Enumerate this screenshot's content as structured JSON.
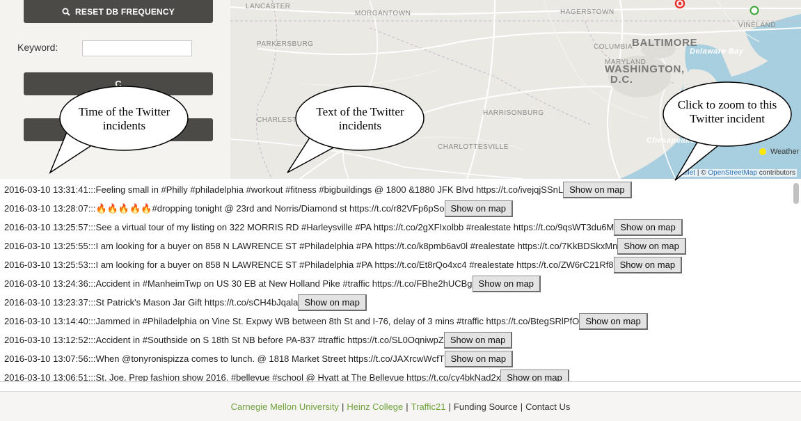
{
  "left_panel": {
    "reset_button_label": "RESET DB FREQUENCY",
    "keyword_label": "Keyword:",
    "keyword_value": "",
    "button2_label": "C",
    "button3_label": ""
  },
  "map": {
    "cities": {
      "lancaster": "LANCASTER",
      "morgantown": "MORGANTOWN",
      "hagerstown": "HAGERSTOWN",
      "vineland": "VINELAND",
      "parkersburg": "PARKERSBURG",
      "columbia": "COLUMBIA",
      "baltimore": "BALTIMORE",
      "maryland": "MARYLAND",
      "washington": "WASHINGTON,",
      "dc": "D.C.",
      "harrisonburg": "HARRISONBURG",
      "charleston": "CHARLEST",
      "charlottesville": "CHARLOTTESVILLE"
    },
    "bays": {
      "delaware": "Delaware Bay",
      "chesapeake": "Chesapeake"
    },
    "weather_label": "Weather",
    "attribution": {
      "leaflet": "aflet",
      "sep": " | © ",
      "osm": "OpenStreetMap",
      "contributors": " contributors"
    },
    "marker_colors": {
      "red": "#e8322c",
      "green": "#3aa93a"
    }
  },
  "callouts": {
    "time": "Time of the Twitter incidents",
    "text": "Text of the Twitter incidents",
    "zoom": "Click to zoom to this Twitter incident"
  },
  "tweets": [
    {
      "text": "2016-03-10 13:31:41:::Feeling small in #Philly #philadelphia #workout #fitness #bigbuildings @ 1800 &1880 JFK Blvd https://t.co/ivejqjSSnL",
      "button": "Show on map"
    },
    {
      "text": "2016-03-10 13:28:07:::",
      "emoji": "🔥🔥🔥🔥🔥",
      "text2": " #dropping tonight @ 23rd and Norris/Diamond st https://t.co/r82VFp6pSo",
      "button": "Show on map"
    },
    {
      "text": "2016-03-10 13:25:57:::See a virtual tour of my listing on 322 MORRIS RD #Harleysville #PA https://t.co/2gXFIxolbb #realestate https://t.co/9qsWT3du6M",
      "button": "Show on map"
    },
    {
      "text": "2016-03-10 13:25:55:::I am looking for a buyer on 858 N LAWRENCE ST #Philadelphia #PA https://t.co/k8pmb6av0l #realestate https://t.co/7KkBDSkxMn",
      "button": "Show on map"
    },
    {
      "text": "2016-03-10 13:25:53:::I am looking for a buyer on 858 N LAWRENCE ST #Philadelphia #PA https://t.co/Et8rQo4xc4 #realestate https://t.co/ZW6rC21Rf8",
      "button": "Show on map"
    },
    {
      "text": "2016-03-10 13:24:36:::Accident in #ManheimTwp on US 30 EB at New Holland Pike #traffic https://t.co/FBhe2hUCBg",
      "button": "Show on map"
    },
    {
      "text": "2016-03-10 13:23:37:::St Patrick's Mason Jar Gift https://t.co/sCH4bJqala",
      "button": "Show on map"
    },
    {
      "text": "2016-03-10 13:14:40:::Jammed in #Philadelphia on Vine St. Expwy WB between 8th St and I-76, delay of 3 mins #traffic https://t.co/BtegSRlPfO",
      "button": "Show on map"
    },
    {
      "text": "2016-03-10 13:12:52:::Accident in #Southside on S 18th St NB before PA-837 #traffic https://t.co/SL0OqniwpZ",
      "button": "Show on map"
    },
    {
      "text": "2016-03-10 13:07:56:::When @tonyronispizza comes to lunch. @ 1818 Market Street https://t.co/JAXrcwWcfT",
      "button": "Show on map"
    },
    {
      "text": "2016-03-10 13:06:51:::St. Joe. Prep fashion show 2016. #bellevue #school @ Hyatt at The Bellevue https://t.co/cy4bkNad2x",
      "button": "Show on map"
    }
  ],
  "footer": {
    "cmu": "Carnegie Mellon University",
    "heinz": "Heinz College",
    "traffic21": "Traffic21",
    "funding": "Funding Source",
    "contact": "Contact Us",
    "sep": "|"
  }
}
